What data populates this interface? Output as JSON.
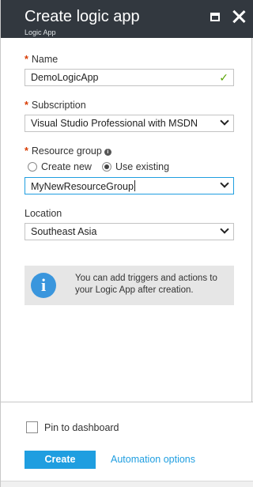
{
  "header": {
    "title": "Create logic app",
    "subtitle": "Logic App"
  },
  "form": {
    "name": {
      "label": "Name",
      "value": "DemoLogicApp",
      "required": true
    },
    "subscription": {
      "label": "Subscription",
      "value": "Visual Studio Professional with MSDN",
      "required": true
    },
    "resource_group": {
      "label": "Resource group",
      "required": true,
      "options": [
        "Create new",
        "Use existing"
      ],
      "selected_option": "Use existing",
      "value": "MyNewResourceGroup"
    },
    "location": {
      "label": "Location",
      "value": "Southeast Asia"
    }
  },
  "info": {
    "message": "You can add triggers and actions to your Logic App after creation."
  },
  "footer": {
    "pin_label": "Pin to dashboard",
    "pin_checked": false,
    "create_label": "Create",
    "automation_label": "Automation options"
  },
  "colors": {
    "header_bg": "#32383f",
    "accent": "#1f9ee0",
    "required": "#d83b01",
    "valid_check": "#57a300"
  }
}
